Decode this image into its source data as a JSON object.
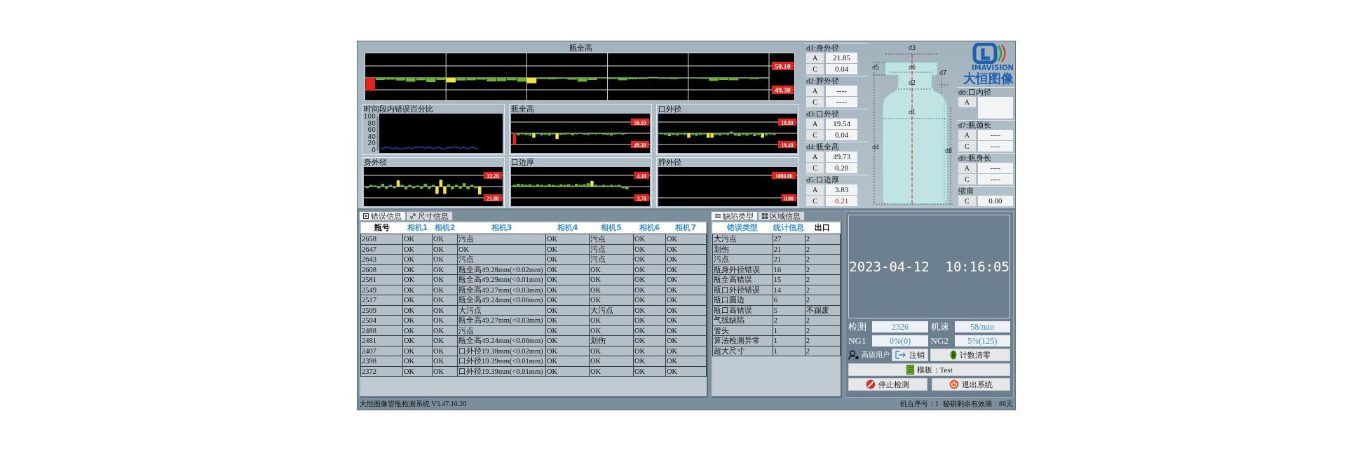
{
  "main_chart": {
    "title": "瓶全高",
    "tick_labels": [
      "50.10",
      "49.30"
    ]
  },
  "small_charts": [
    {
      "kind": "line",
      "chart_data": {
        "type": "line",
        "title": "时间段内错误百分比",
        "ylim": [
          0,
          100
        ],
        "yticks": [
          0,
          20,
          40,
          60,
          80,
          100
        ],
        "series": [
          {
            "color": "#2448b8",
            "values": [
              3,
              5,
              9,
              8,
              6,
              4,
              7,
              5,
              3,
              6,
              4,
              8,
              5,
              6,
              9,
              7,
              10,
              8,
              5,
              9,
              8,
              4,
              7,
              9,
              6,
              3,
              5,
              8,
              6,
              10,
              7,
              8,
              5,
              9,
              6,
              4,
              8,
              9,
              5,
              4
            ]
          }
        ]
      }
    },
    {
      "kind": "bars",
      "title": "瓶全高",
      "tick_labels": [
        "50.10",
        "49.30"
      ]
    },
    {
      "kind": "bars",
      "title": "口外径",
      "tick_labels": [
        "19.80",
        "19.40"
      ]
    },
    {
      "kind": "bars",
      "title": "身外径",
      "tick_labels": [
        "22.20",
        "21.80"
      ]
    },
    {
      "kind": "bars",
      "title": "口边厚",
      "tick_labels": [
        "4.10",
        "3.70"
      ]
    },
    {
      "kind": "empty",
      "title": "脖外径",
      "tick_labels": [
        "1000.00",
        "0.00"
      ]
    }
  ],
  "measurements_left": [
    {
      "label": "d1:身外径",
      "rows": [
        {
          "key": "A",
          "value": "21.85",
          "alarm": false
        },
        {
          "key": "C",
          "value": "0.04",
          "alarm": false
        }
      ]
    },
    {
      "label": "d2:脖外径",
      "rows": [
        {
          "key": "A",
          "value": "----",
          "alarm": false
        },
        {
          "key": "C",
          "value": "----",
          "alarm": false
        }
      ]
    },
    {
      "label": "d3:口外径",
      "rows": [
        {
          "key": "A",
          "value": "19.54",
          "alarm": false
        },
        {
          "key": "C",
          "value": "0.04",
          "alarm": false
        }
      ]
    },
    {
      "label": "d4:瓶全高",
      "rows": [
        {
          "key": "A",
          "value": "49.73",
          "alarm": false
        },
        {
          "key": "C",
          "value": "0.28",
          "alarm": false
        }
      ]
    },
    {
      "label": "d5:口边厚",
      "rows": [
        {
          "key": "A",
          "value": "3.83",
          "alarm": false
        },
        {
          "key": "C",
          "value": "0.21",
          "alarm": true
        }
      ]
    }
  ],
  "bottle_labels": [
    "d3",
    "d5",
    "d6",
    "d7",
    "d2",
    "d1",
    "d4",
    "d8"
  ],
  "logo": {
    "brand": "IMAVISION",
    "name": "大恒图像"
  },
  "measurements_right": [
    {
      "label": "d6:口内径",
      "rows": [
        {
          "key": "A"
        }
      ]
    },
    {
      "label": "d7:瓶颈长",
      "rows": [
        {
          "key": "A",
          "value": "----",
          "alarm": false
        },
        {
          "key": "C",
          "value": "----",
          "alarm": false
        }
      ]
    },
    {
      "label": "d8:瓶身长",
      "rows": [
        {
          "key": "A",
          "value": "----",
          "alarm": false
        },
        {
          "key": "C",
          "value": "----",
          "alarm": false
        }
      ]
    },
    {
      "label": "缩肩",
      "rows": [
        {
          "key": "C",
          "value": "0.00",
          "alarm": false
        }
      ]
    }
  ],
  "error_tabs": [
    {
      "label": "错误信息",
      "selected": true
    },
    {
      "label": "尺寸信息",
      "selected": false
    }
  ],
  "error_table": {
    "columns": [
      {
        "label": "瓶号",
        "color": "#000000"
      },
      {
        "label": "相机1",
        "color": "#3b8fd6"
      },
      {
        "label": "相机2",
        "color": "#3b8fd6"
      },
      {
        "label": "相机3",
        "color": "#3b8fd6"
      },
      {
        "label": "相机4",
        "color": "#3b8fd6"
      },
      {
        "label": "相机5",
        "color": "#3b8fd6"
      },
      {
        "label": "相机6",
        "color": "#3b8fd6"
      },
      {
        "label": "相机7",
        "color": "#3b8fd6"
      }
    ],
    "rows": [
      [
        "2658",
        "OK",
        "OK",
        "污点",
        "OK",
        "污点",
        "OK",
        "OK"
      ],
      [
        "2647",
        "OK",
        "OK",
        "OK",
        "OK",
        "污点",
        "OK",
        "OK"
      ],
      [
        "2643",
        "OK",
        "OK",
        "污点",
        "OK",
        "污点",
        "OK",
        "OK"
      ],
      [
        "2608",
        "OK",
        "OK",
        "瓶全高49.28mm(<0.02mm)",
        "OK",
        "OK",
        "OK",
        "OK"
      ],
      [
        "2581",
        "OK",
        "OK",
        "瓶全高49.29mm(<0.01mm)",
        "OK",
        "OK",
        "OK",
        "OK"
      ],
      [
        "2549",
        "OK",
        "OK",
        "瓶全高49.27mm(<0.03mm)",
        "OK",
        "OK",
        "OK",
        "OK"
      ],
      [
        "2517",
        "OK",
        "OK",
        "瓶全高49.24mm(<0.06mm)",
        "OK",
        "OK",
        "OK",
        "OK"
      ],
      [
        "2509",
        "OK",
        "OK",
        "大污点",
        "OK",
        "大污点",
        "OK",
        "OK"
      ],
      [
        "2504",
        "OK",
        "OK",
        "瓶全高49.27mm(<0.03mm)",
        "OK",
        "OK",
        "OK",
        "OK"
      ],
      [
        "2488",
        "OK",
        "OK",
        "污点",
        "OK",
        "OK",
        "OK",
        "OK"
      ],
      [
        "2481",
        "OK",
        "OK",
        "瓶全高49.24mm(<0.06mm)",
        "OK",
        "划伤",
        "OK",
        "OK"
      ],
      [
        "2407",
        "OK",
        "OK",
        "口外径19.38mm(<0.02mm)",
        "OK",
        "OK",
        "OK",
        "OK"
      ],
      [
        "2398",
        "OK",
        "OK",
        "口外径19.39mm(<0.01mm)",
        "OK",
        "OK",
        "OK",
        "OK"
      ],
      [
        "2372",
        "OK",
        "OK",
        "口外径19.39mm(<0.01mm)",
        "OK",
        "OK",
        "OK",
        "OK"
      ]
    ]
  },
  "defect_tabs": [
    {
      "label": "缺陷类型",
      "selected": true
    },
    {
      "label": "区域信息",
      "selected": false
    }
  ],
  "defect_table": {
    "columns": [
      {
        "label": "错误类型",
        "color": "#3b8fd6"
      },
      {
        "label": "统计信息",
        "color": "#3b8fd6"
      },
      {
        "label": "出口",
        "color": "#000000"
      }
    ],
    "rows": [
      [
        "大污点",
        "27",
        "2"
      ],
      [
        "划伤",
        "21",
        "2"
      ],
      [
        "污点",
        "21",
        "2"
      ],
      [
        "瓶身外径错误",
        "16",
        "2"
      ],
      [
        "瓶全高错误",
        "15",
        "2"
      ],
      [
        "瓶口外径错误",
        "14",
        "2"
      ],
      [
        "瓶口圆边",
        "6",
        "2"
      ],
      [
        "瓶口高错误",
        "5",
        "不踢废"
      ],
      [
        "气线缺陷",
        "2",
        "2"
      ],
      [
        "管头",
        "1",
        "2"
      ],
      [
        "算法检测异常",
        "1",
        "2"
      ],
      [
        "超大尺寸",
        "1",
        "2"
      ]
    ]
  },
  "clock": "2023-04-12  10:16:05",
  "stats": [
    {
      "label": "检测",
      "value": "2326"
    },
    {
      "label": "机速",
      "value": "58/min"
    },
    {
      "label": "NG1",
      "value": "0%(0)"
    },
    {
      "label": "NG2",
      "value": "5%(125)"
    }
  ],
  "user": "高级用户",
  "logout_button": "注销",
  "reset_button": "计数清零",
  "template_button": "模板：Test",
  "stop_button": "停止检测",
  "exit_button": "退出系统",
  "status_bar": {
    "version": "大恒图像管瓶检测系统 V3.47.10.20",
    "station": "机台序号：1",
    "license": "秘钥剩余有效期：86天"
  }
}
